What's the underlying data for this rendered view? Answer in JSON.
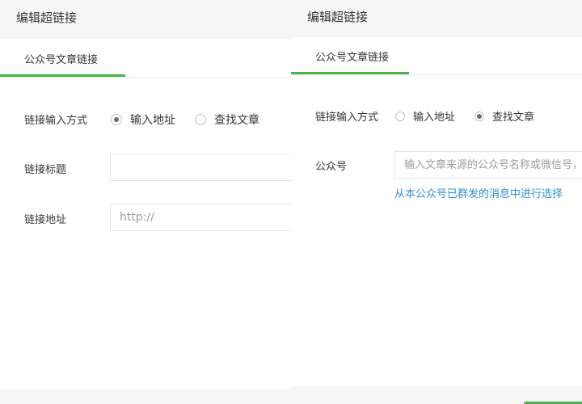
{
  "left_panel": {
    "title": "编辑超链接",
    "tab_label": "公众号文章链接",
    "input_mode": {
      "label": "链接输入方式",
      "options": [
        {
          "label": "输入地址",
          "checked": true
        },
        {
          "label": "查找文章",
          "checked": false
        }
      ]
    },
    "link_title": {
      "label": "链接标题",
      "value": ""
    },
    "link_address": {
      "label": "链接地址",
      "placeholder": "http://"
    }
  },
  "right_panel": {
    "title": "编辑超链接",
    "tab_label": "公众号文章链接",
    "input_mode": {
      "label": "链接输入方式",
      "options": [
        {
          "label": "输入地址",
          "checked": false
        },
        {
          "label": "查找文章",
          "checked": true
        }
      ]
    },
    "account": {
      "label": "公众号",
      "placeholder": "输入文章来源的公众号名称或微信号，回车进行搜索"
    },
    "select_from_own_link": "从本公众号已群发的消息中进行选择"
  },
  "colors": {
    "accent_green": "#44b549",
    "link_blue": "#2e8fd8",
    "title_bg": "#f6f6f6"
  }
}
